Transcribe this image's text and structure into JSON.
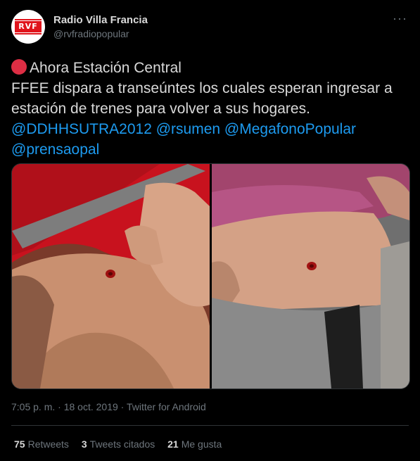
{
  "account": {
    "display_name": "Radio Villa Francia",
    "handle": "@rvfradiopopular",
    "avatar_text": "RVF"
  },
  "menu": {
    "more": "···"
  },
  "tweet": {
    "line1": "Ahora Estación Central",
    "line2": "FFEE dispara a transeúntes los cuales esperan ingresar a",
    "line3": "estación de trenes para volver a sus hogares.",
    "mentions": [
      "@DDHHSUTRA2012",
      "@rsumen",
      "@MegafonoPopular",
      "@prensaopal"
    ]
  },
  "media": {
    "photos": [
      "photo-1",
      "photo-2"
    ]
  },
  "meta": {
    "time": "7:05 p. m.",
    "date": "18 oct. 2019",
    "source": "Twitter for Android",
    "sep": " · "
  },
  "stats": {
    "retweets_count": "75",
    "retweets_label": "Retweets",
    "quotes_count": "3",
    "quotes_label": "Tweets citados",
    "likes_count": "21",
    "likes_label": "Me gusta"
  },
  "colors": {
    "background": "#000000",
    "text": "#d9d9d9",
    "secondary": "#6e767d",
    "mention": "#1d9bf0",
    "emoji_red": "#dd2e44"
  }
}
